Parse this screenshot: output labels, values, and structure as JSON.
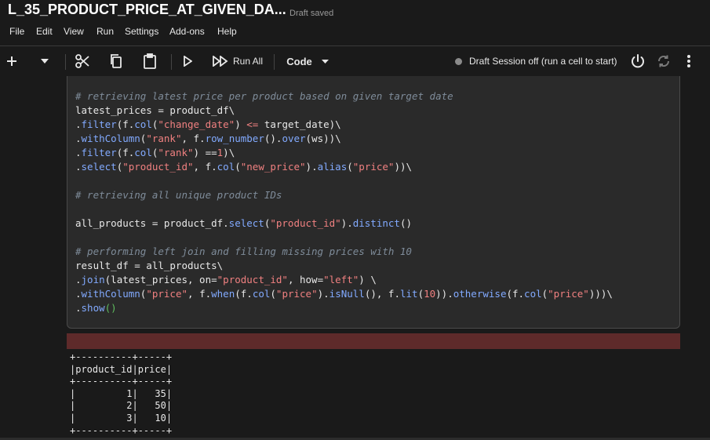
{
  "notebook": {
    "title": "L_35_PRODUCT_PRICE_AT_GIVEN_DA...",
    "save_status": "Draft saved"
  },
  "menu": [
    "File",
    "Edit",
    "View",
    "Run",
    "Settings",
    "Add-ons",
    "Help"
  ],
  "toolbar": {
    "run_all_label": "Run All",
    "cell_type_label": "Code",
    "session_status": "Draft Session off (run a cell to start)"
  },
  "icons": {
    "add": "plus-icon",
    "dropdown": "chevron-down-icon",
    "cut": "scissors-icon",
    "copy": "copy-icon",
    "paste": "clipboard-icon",
    "run": "play-icon",
    "run_all": "fast-forward-icon",
    "power": "power-icon",
    "refresh": "refresh-icon",
    "more": "more-vert-icon"
  },
  "colors": {
    "comment": "#7f8c9a",
    "string": "#f08080",
    "method": "#82aaff",
    "error_bar": "#5e2a2a"
  },
  "cell": {
    "lines": [
      "# retrieving latest price per product based on given target date",
      "latest_prices = product_df\\",
      ".filter(f.col(\"change_date\") <= target_date)\\",
      ".withColumn(\"rank\", f.row_number().over(ws))\\",
      ".filter(f.col(\"rank\") ==1)\\",
      ".select(\"product_id\", f.col(\"new_price\").alias(\"price\"))\\",
      "",
      "# retrieving all unique product IDs",
      "",
      "all_products = product_df.select(\"product_id\").distinct()",
      "",
      "# performing left join and filling missing prices with 10",
      "result_df = all_products\\",
      ".join(latest_prices, on=\"product_id\", how=\"left\") \\",
      ".withColumn(\"price\", f.when(f.col(\"price\").isNull(), f.lit(10)).otherwise(f.col(\"price\")))\\",
      ".show()"
    ]
  },
  "output": {
    "lines": [
      "+----------+-----+",
      "|product_id|price|",
      "+----------+-----+",
      "|         1|   35|",
      "|         2|   50|",
      "|         3|   10|",
      "+----------+-----+"
    ]
  }
}
